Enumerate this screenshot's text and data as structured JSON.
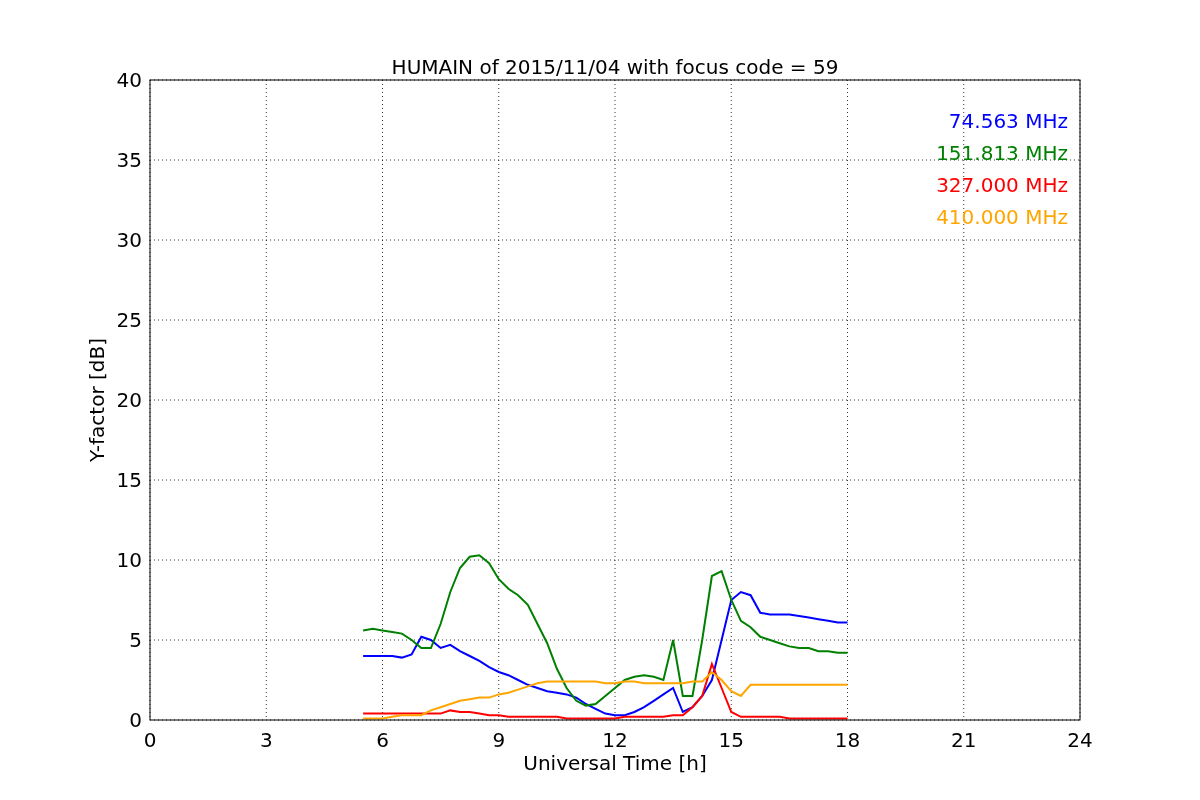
{
  "chart_data": {
    "type": "line",
    "title": "HUMAIN of 2015/11/04 with focus code = 59",
    "xlabel": "Universal Time [h]",
    "ylabel": "Y-factor [dB]",
    "xlim": [
      0,
      24
    ],
    "ylim": [
      0,
      40
    ],
    "xticks": [
      0,
      3,
      6,
      9,
      12,
      15,
      18,
      21,
      24
    ],
    "yticks": [
      0,
      5,
      10,
      15,
      20,
      25,
      30,
      35,
      40
    ],
    "x": [
      5.5,
      5.75,
      6,
      6.25,
      6.5,
      6.75,
      7,
      7.25,
      7.5,
      7.75,
      8,
      8.25,
      8.5,
      8.75,
      9,
      9.25,
      9.5,
      9.75,
      10,
      10.25,
      10.5,
      10.75,
      11,
      11.25,
      11.5,
      11.75,
      12,
      12.25,
      12.5,
      12.75,
      13,
      13.25,
      13.5,
      13.75,
      14,
      14.25,
      14.5,
      14.75,
      15,
      15.25,
      15.5,
      15.75,
      16,
      16.25,
      16.5,
      16.75,
      17,
      17.25,
      17.5,
      17.75,
      18
    ],
    "series": [
      {
        "name": "74.563 MHz",
        "color": "#0000ff",
        "values": [
          4.0,
          4.0,
          4.0,
          4.0,
          3.9,
          4.1,
          5.2,
          5.0,
          4.5,
          4.7,
          4.3,
          4.0,
          3.7,
          3.3,
          3.0,
          2.8,
          2.5,
          2.2,
          2.0,
          1.8,
          1.7,
          1.6,
          1.4,
          1.0,
          0.7,
          0.4,
          0.3,
          0.3,
          0.5,
          0.8,
          1.2,
          1.6,
          2.0,
          0.5,
          0.8,
          1.5,
          2.5,
          5.0,
          7.5,
          8.0,
          7.8,
          6.7,
          6.6,
          6.6,
          6.6,
          6.5,
          6.4,
          6.3,
          6.2,
          6.1,
          6.1
        ]
      },
      {
        "name": "151.813 MHz",
        "color": "#008000",
        "values": [
          5.6,
          5.7,
          5.6,
          5.5,
          5.4,
          5.0,
          4.5,
          4.5,
          6.0,
          8.0,
          9.5,
          10.2,
          10.3,
          9.8,
          8.8,
          8.2,
          7.8,
          7.2,
          6.0,
          4.8,
          3.2,
          2.0,
          1.2,
          0.9,
          1.0,
          1.5,
          2.0,
          2.5,
          2.7,
          2.8,
          2.7,
          2.5,
          5.0,
          1.5,
          1.5,
          5.0,
          9.0,
          9.3,
          7.5,
          6.2,
          5.8,
          5.2,
          5.0,
          4.8,
          4.6,
          4.5,
          4.5,
          4.3,
          4.3,
          4.2,
          4.2
        ]
      },
      {
        "name": "327.000 MHz",
        "color": "#ff0000",
        "values": [
          0.4,
          0.4,
          0.4,
          0.4,
          0.4,
          0.4,
          0.4,
          0.4,
          0.4,
          0.6,
          0.5,
          0.5,
          0.4,
          0.3,
          0.3,
          0.2,
          0.2,
          0.2,
          0.2,
          0.2,
          0.2,
          0.1,
          0.1,
          0.1,
          0.1,
          0.1,
          0.1,
          0.2,
          0.2,
          0.2,
          0.2,
          0.2,
          0.3,
          0.3,
          0.8,
          1.5,
          3.5,
          2.0,
          0.5,
          0.2,
          0.2,
          0.2,
          0.2,
          0.2,
          0.1,
          0.1,
          0.1,
          0.1,
          0.1,
          0.1,
          0.1
        ]
      },
      {
        "name": "410.000 MHz",
        "color": "#ffa500",
        "values": [
          0.1,
          0.1,
          0.1,
          0.2,
          0.3,
          0.3,
          0.3,
          0.6,
          0.8,
          1.0,
          1.2,
          1.3,
          1.4,
          1.4,
          1.6,
          1.7,
          1.9,
          2.1,
          2.3,
          2.4,
          2.4,
          2.4,
          2.4,
          2.4,
          2.4,
          2.3,
          2.3,
          2.4,
          2.4,
          2.3,
          2.3,
          2.3,
          2.3,
          2.3,
          2.4,
          2.4,
          3.0,
          2.5,
          1.8,
          1.5,
          2.2,
          2.2,
          2.2,
          2.2,
          2.2,
          2.2,
          2.2,
          2.2,
          2.2,
          2.2,
          2.2
        ]
      }
    ],
    "grid": true
  }
}
